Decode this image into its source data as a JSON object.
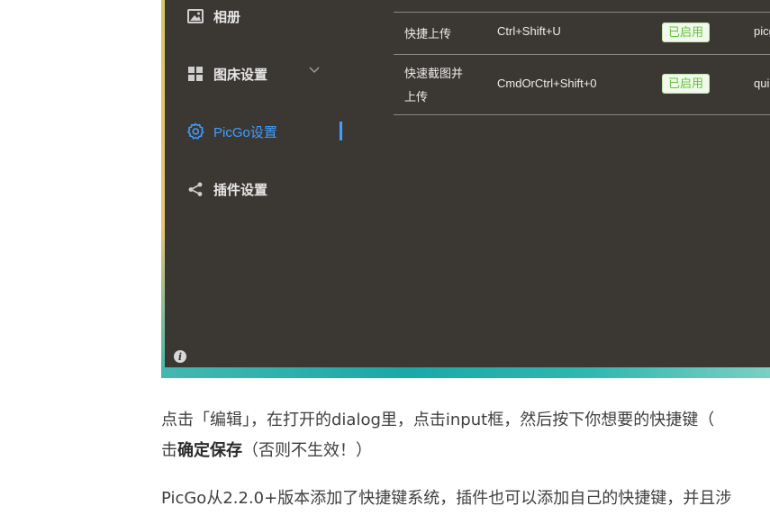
{
  "sidebar": {
    "items": [
      {
        "label": "相册",
        "icon": "picture-icon"
      },
      {
        "label": "图床设置",
        "icon": "grid-icon"
      },
      {
        "label": "PicGo设置",
        "icon": "gear-icon"
      },
      {
        "label": "插件设置",
        "icon": "share-icon"
      }
    ],
    "info_icon": "info-icon"
  },
  "shortcuts": {
    "rows": [
      {
        "name": "快捷上传",
        "key": "Ctrl+Shift+U",
        "status": "已启用",
        "source": "picgo"
      },
      {
        "name_line1": "快速截图并",
        "name_line2": "上传",
        "key": "CmdOrCtrl+Shift+0",
        "status": "已启用",
        "source": "quick"
      }
    ]
  },
  "article": {
    "p1_line1": "点击「编辑」，在打开的dialog里，点击input框，然后按下你想要的快捷键（",
    "p1_line2_pre": "击",
    "p1_line2_bold": "确定保存",
    "p1_line2_post": "（否则不生效！）",
    "p2_line1": "PicGo从2.2.0+版本添加了快捷键系统，插件也可以添加自己的快捷键，并且涉"
  },
  "colors": {
    "app_bg": "#3b3834",
    "accent": "#409eff",
    "tag_green": "#67c23a"
  }
}
